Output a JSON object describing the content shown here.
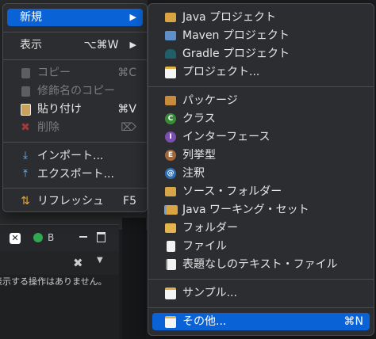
{
  "context_menu": {
    "new": {
      "label": "新規",
      "arrow": "▶"
    },
    "show": {
      "label": "表示",
      "shortcut": "⌥⌘W",
      "arrow": "▶"
    },
    "copy": {
      "label": "コピー",
      "shortcut": "⌘C"
    },
    "copy_qualified": {
      "label": "修飾名のコピー"
    },
    "paste": {
      "label": "貼り付け",
      "shortcut": "⌘V"
    },
    "delete": {
      "label": "削除",
      "shortcut": "⌦"
    },
    "import": {
      "label": "インポート..."
    },
    "export": {
      "label": "エクスポート..."
    },
    "refresh": {
      "label": "リフレッシュ",
      "shortcut": "F5"
    }
  },
  "new_submenu": {
    "items": [
      {
        "label": "Java プロジェクト"
      },
      {
        "label": "Maven プロジェクト"
      },
      {
        "label": "Gradle プロジェクト"
      },
      {
        "label": "プロジェクト..."
      },
      {
        "label": "パッケージ"
      },
      {
        "label": "クラス"
      },
      {
        "label": "インターフェース"
      },
      {
        "label": "列挙型"
      },
      {
        "label": "注釈"
      },
      {
        "label": "ソース・フォルダー"
      },
      {
        "label": "Java ワーキング・セット"
      },
      {
        "label": "フォルダー"
      },
      {
        "label": "ファイル"
      },
      {
        "label": "表題なしのテキスト・ファイル"
      },
      {
        "label": "サンプル..."
      },
      {
        "label": "その他...",
        "shortcut": "⌘N"
      }
    ]
  },
  "background": {
    "tab_label": "B",
    "empty_message": "表示する操作はありません。"
  },
  "colors": {
    "highlight": "#0a63d6",
    "menu_bg": "#2c2d30"
  }
}
